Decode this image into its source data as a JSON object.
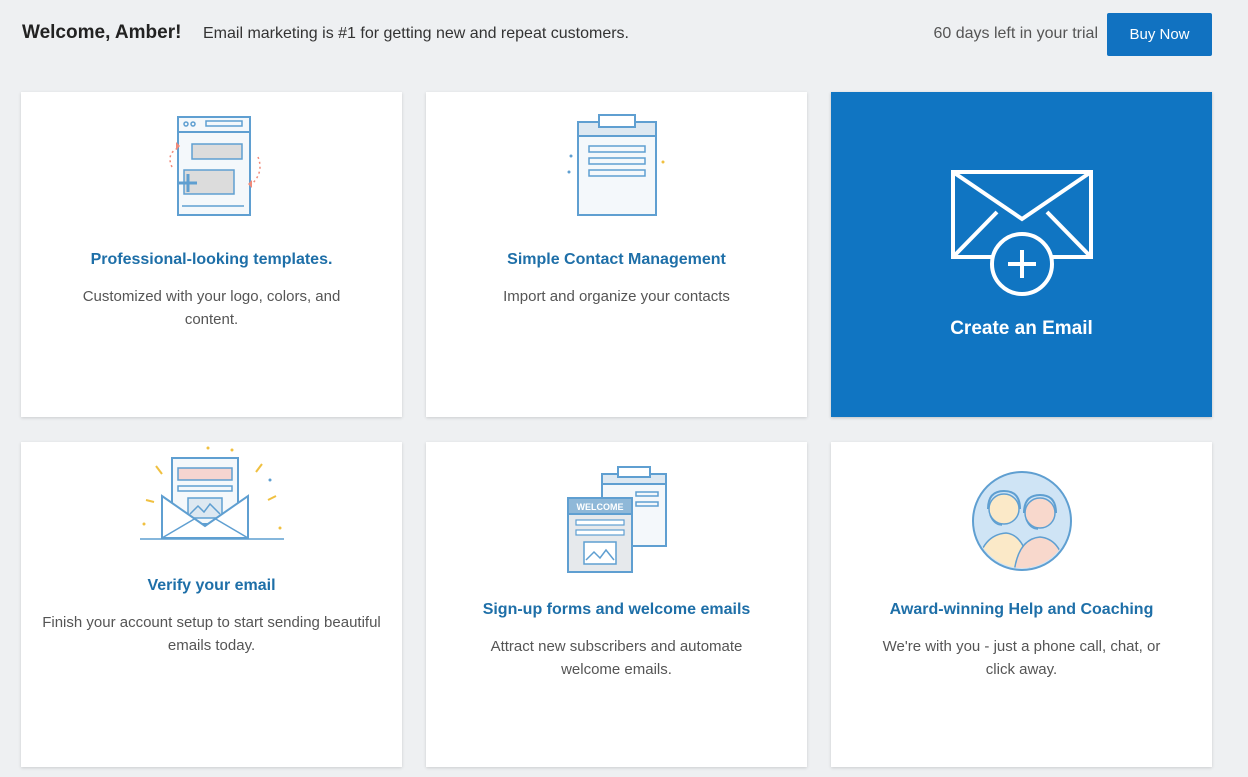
{
  "header": {
    "welcome": "Welcome, Amber!",
    "tagline": "Email marketing is #1 for getting new and repeat customers.",
    "trial_text": "60 days left in your trial",
    "buy_label": "Buy Now"
  },
  "cards": {
    "templates": {
      "icon": "template-editor-icon",
      "title": "Professional-looking templates.",
      "desc": "Customized with your logo, colors, and content."
    },
    "contacts": {
      "icon": "clipboard-list-icon",
      "title": "Simple Contact Management",
      "desc": "Import and organize your contacts"
    },
    "create": {
      "icon": "envelope-plus-icon",
      "title": "Create an Email"
    },
    "verify": {
      "icon": "open-envelope-icon",
      "title": "Verify your email",
      "desc": "Finish your account setup to start sending beautiful emails today."
    },
    "signup": {
      "icon": "welcome-form-icon",
      "badge": "WELCOME",
      "title": "Sign-up forms and welcome emails",
      "desc": "Attract new subscribers and automate welcome emails."
    },
    "help": {
      "icon": "support-agents-icon",
      "title": "Award-winning Help and Coaching",
      "desc": "We're with you - just a phone call, chat, or click away."
    }
  },
  "colors": {
    "accent": "#1075c2",
    "title_blue": "#1e6fa8",
    "background": "#eef0f2"
  }
}
